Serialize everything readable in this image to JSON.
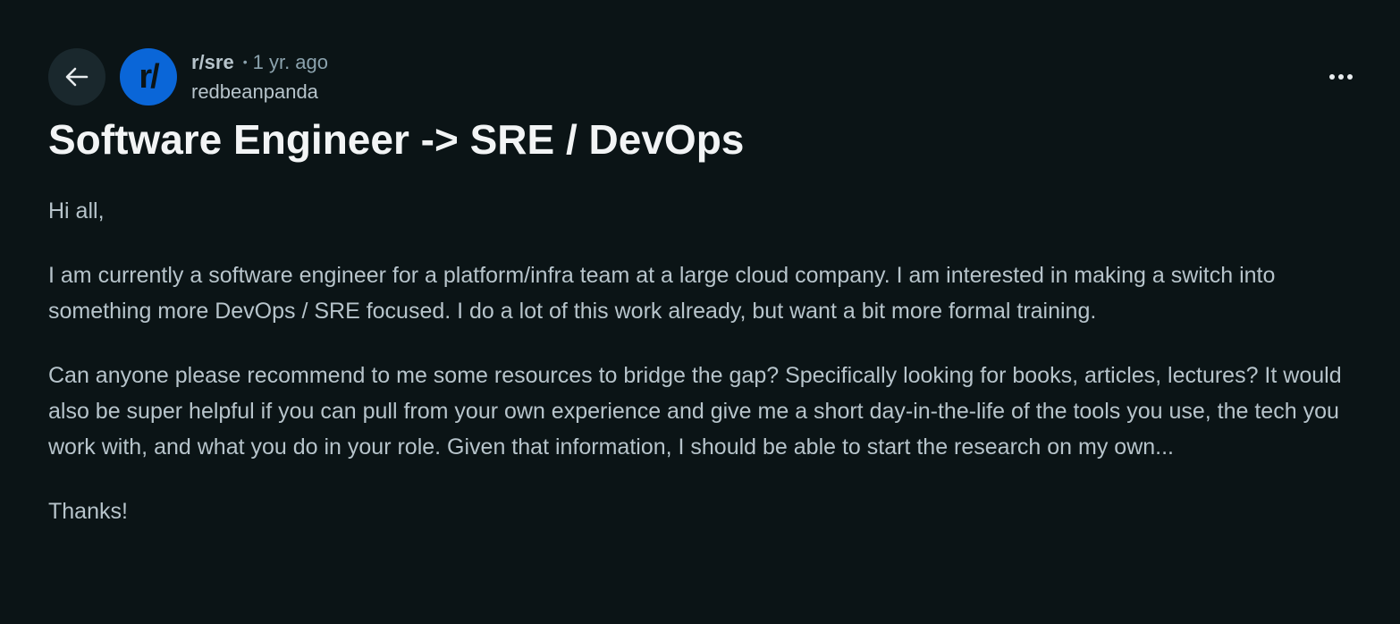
{
  "post": {
    "subreddit": "r/sre",
    "separator": "•",
    "time_ago": "1 yr. ago",
    "author": "redbeanpanda",
    "avatar_text": "r/",
    "title": "Software Engineer -> SRE / DevOps",
    "paragraphs": [
      "Hi all,",
      "I am currently a software engineer for a platform/infra team at a large cloud company. I am interested in making a switch into something more DevOps / SRE focused. I do a lot of this work already, but want a bit more formal training.",
      "Can anyone please recommend to me some resources to bridge the gap? Specifically looking for books, articles, lectures? It would also be super helpful if you can pull from your own experience and give me a short day-in-the-life of the tools you use, the tech you work with, and what you do in your role. Given that information, I should be able to start the research on my own...",
      "Thanks!"
    ]
  },
  "icons": {
    "back": "back-arrow-icon",
    "more": "more-options-icon"
  },
  "colors": {
    "background": "#0b1416",
    "avatar_bg": "#0a66d8",
    "title": "#f2f4f5",
    "body_text": "#b7c4cb",
    "muted": "#8ba2ad",
    "back_button_bg": "#1a282d"
  }
}
